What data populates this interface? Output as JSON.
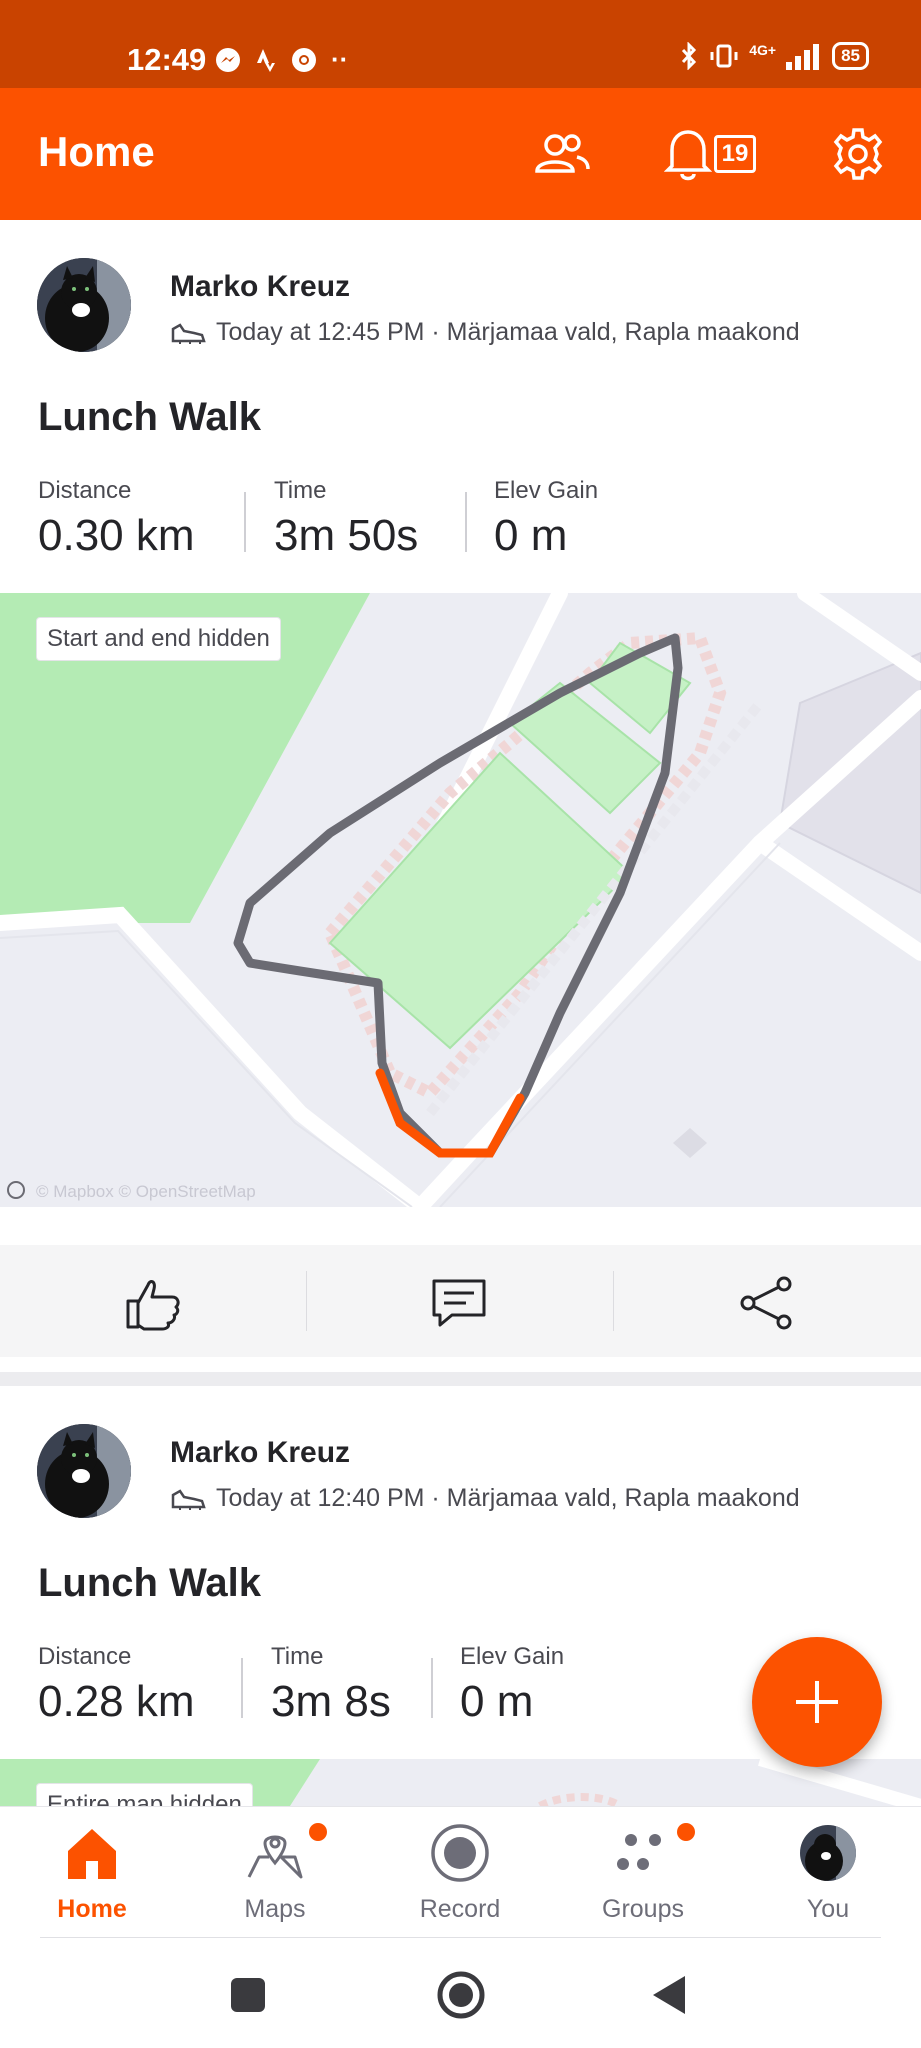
{
  "status_bar": {
    "time": "12:49",
    "network": "4G+",
    "battery": "85"
  },
  "app_bar": {
    "title": "Home",
    "notification_count": "19"
  },
  "feed": [
    {
      "athlete": "Marko Kreuz",
      "meta": "Today at 12:45 PM · Märjamaa vald, Rapla maakond",
      "title": "Lunch Walk",
      "stats": [
        {
          "label": "Distance",
          "value": "0.30 km"
        },
        {
          "label": "Time",
          "value": "3m 50s"
        },
        {
          "label": "Elev Gain",
          "value": "0 m"
        }
      ],
      "map_chip": "Start and end hidden",
      "map_attribution": "© Mapbox © OpenStreetMap"
    },
    {
      "athlete": "Marko Kreuz",
      "meta": "Today at 12:40 PM · Märjamaa vald, Rapla maakond",
      "title": "Lunch Walk",
      "stats": [
        {
          "label": "Distance",
          "value": "0.28 km"
        },
        {
          "label": "Time",
          "value": "3m 8s"
        },
        {
          "label": "Elev Gain",
          "value": "0 m"
        }
      ],
      "map_chip": "Entire map hidden"
    }
  ],
  "bottom_nav": [
    {
      "label": "Home",
      "icon": "home-icon",
      "active": true
    },
    {
      "label": "Maps",
      "icon": "maps-icon",
      "badge": true
    },
    {
      "label": "Record",
      "icon": "record-icon"
    },
    {
      "label": "Groups",
      "icon": "groups-icon",
      "badge": true
    },
    {
      "label": "You",
      "icon": "avatar"
    }
  ],
  "colors": {
    "brand": "#fc5200",
    "status_bar": "#c94300",
    "route": "#6b6b73",
    "route_highlight": "#fc5200",
    "park": "#b3ebb3"
  }
}
